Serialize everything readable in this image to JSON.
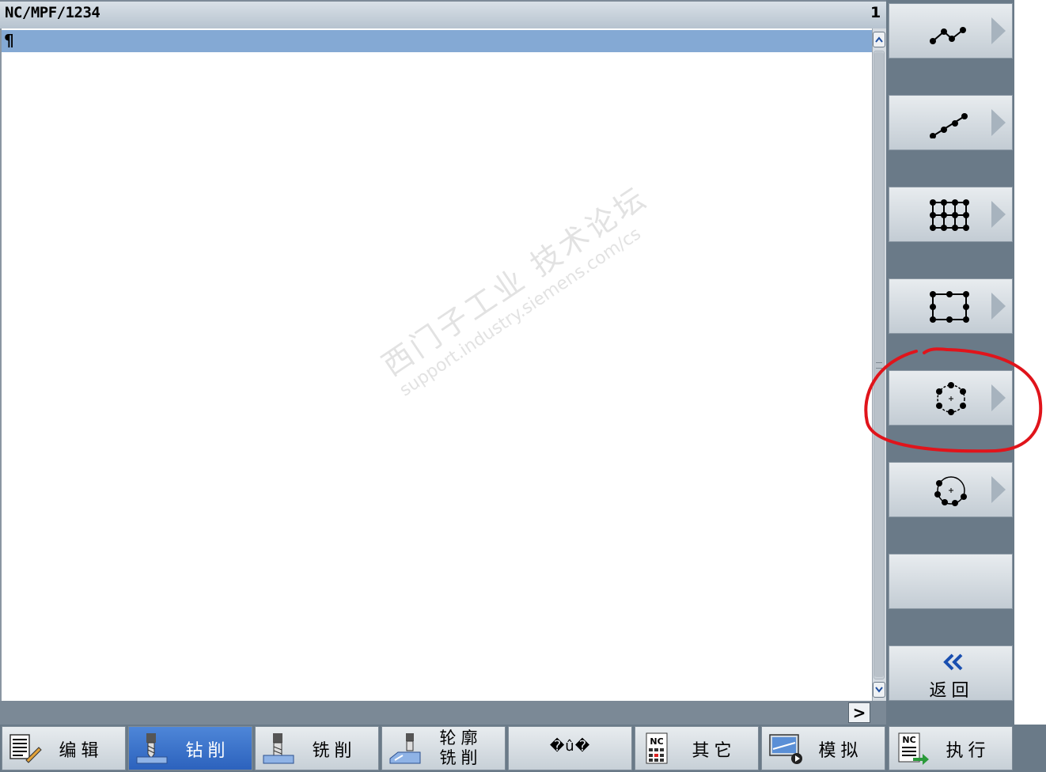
{
  "title": {
    "path": "NC/MPF/1234",
    "line_number": "1"
  },
  "editor": {
    "current_line_text": "¶"
  },
  "scrollbar": {
    "up_icon": "chevron-up-icon",
    "down_icon": "chevron-down-icon"
  },
  "statusbar": {
    "more_label": ">"
  },
  "vertical_softkeys": [
    {
      "name": "position-free",
      "icon": "free-positions-icon"
    },
    {
      "name": "position-line",
      "icon": "line-positions-icon"
    },
    {
      "name": "position-grid",
      "icon": "grid-positions-icon"
    },
    {
      "name": "position-frame",
      "icon": "frame-positions-icon"
    },
    {
      "name": "position-full-circle",
      "icon": "full-circle-positions-icon"
    },
    {
      "name": "position-pitch-circle",
      "icon": "pitch-circle-positions-icon"
    },
    {
      "name": "empty",
      "icon": ""
    },
    {
      "name": "back",
      "icon": "double-chevron-left-icon",
      "label": "返回"
    }
  ],
  "horizontal_softkeys": [
    {
      "label": "编辑",
      "icon": "edit-icon",
      "active": false
    },
    {
      "label": "钻削",
      "icon": "drill-icon",
      "active": true
    },
    {
      "label": "铣削",
      "icon": "mill-icon",
      "active": false
    },
    {
      "label_line1": "轮廓",
      "label_line2": "铣削",
      "icon": "contour-mill-icon",
      "active": false
    },
    {
      "label": "�û�",
      "icon": "",
      "active": false
    },
    {
      "label": "其它",
      "icon": "nc-misc-icon",
      "active": false
    },
    {
      "label": "模拟",
      "icon": "simulate-icon",
      "active": false
    },
    {
      "label": "执行",
      "icon": "nc-execute-icon",
      "active": false
    }
  ],
  "watermark": {
    "line1": "西门子工业 技术论坛",
    "line2": "support.industry.siemens.com/cs"
  },
  "colors": {
    "accent": "#2c62bd",
    "current_line": "#84a9d4",
    "panel": "#6a7a88",
    "annotation": "#e0141b"
  }
}
